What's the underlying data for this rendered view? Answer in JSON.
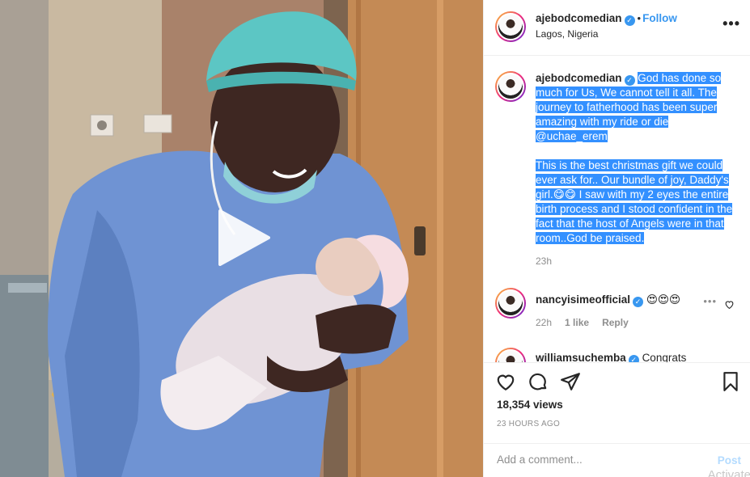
{
  "post": {
    "username": "ajebodcomedian",
    "verified_mark": "✓",
    "separator": "•",
    "follow_label": "Follow",
    "location": "Lagos, Nigeria",
    "more_label": "•••"
  },
  "media": {
    "type": "video",
    "play_icon": "play-icon"
  },
  "comments": [
    {
      "username": "ajebodcomedian",
      "text_p1": "God has done so much for Us, We cannot tell it all. The journey to fatherhood has been super amazing with my ride or die @uchae_erem",
      "text_p2": "This is the best christmas gift we could ever ask for.. Our bundle of joy, Daddy's girl.😋😋 I saw with my 2 eyes the entire birth process and I stood confident in the fact that the host of Angels were in that room..God be praised.",
      "time": "23h"
    },
    {
      "username": "nancyisimeofficial",
      "text": "😍😍😍",
      "time": "22h",
      "likes": "1 like",
      "reply": "Reply",
      "more": "•••"
    },
    {
      "username": "williamsuchemba",
      "text": "Congrats"
    }
  ],
  "actions": {
    "icons": [
      "heart-icon",
      "comment-icon",
      "share-icon",
      "bookmark-icon"
    ],
    "views": "18,354 views",
    "timestamp": "23 HOURS AGO"
  },
  "composer": {
    "placeholder": "Add a comment...",
    "post_label": "Post"
  },
  "overlay": {
    "watermark": "Activate"
  },
  "colors": {
    "link": "#3897f0",
    "highlight": "#3390ff",
    "muted": "#8e8e8e",
    "border": "#efefef"
  }
}
